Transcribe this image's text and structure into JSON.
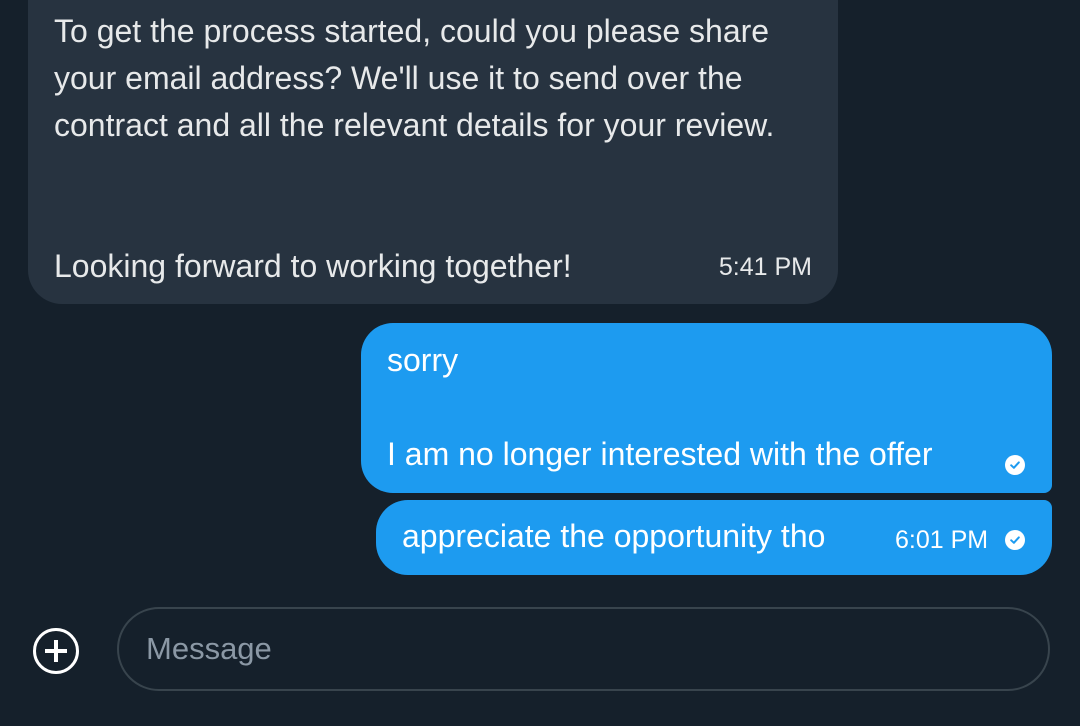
{
  "conversation": {
    "incoming": {
      "paragraph1": "To get the process started, could you please share your email address? We'll use it to send over the contract and all the relevant details for your review.",
      "paragraph2": "Looking forward to working together!",
      "time": "5:41 PM"
    },
    "outgoing": [
      {
        "line1": "sorry",
        "line2": "I am no longer interested with the offer"
      },
      {
        "text": "appreciate the opportunity tho",
        "time": "6:01 PM"
      }
    ]
  },
  "composer": {
    "placeholder": "Message",
    "add_icon": "plus-circle-icon"
  },
  "colors": {
    "background": "#15202b",
    "incoming_bubble": "#273340",
    "outgoing_bubble": "#1d9bf0",
    "input_border": "#38444d"
  }
}
